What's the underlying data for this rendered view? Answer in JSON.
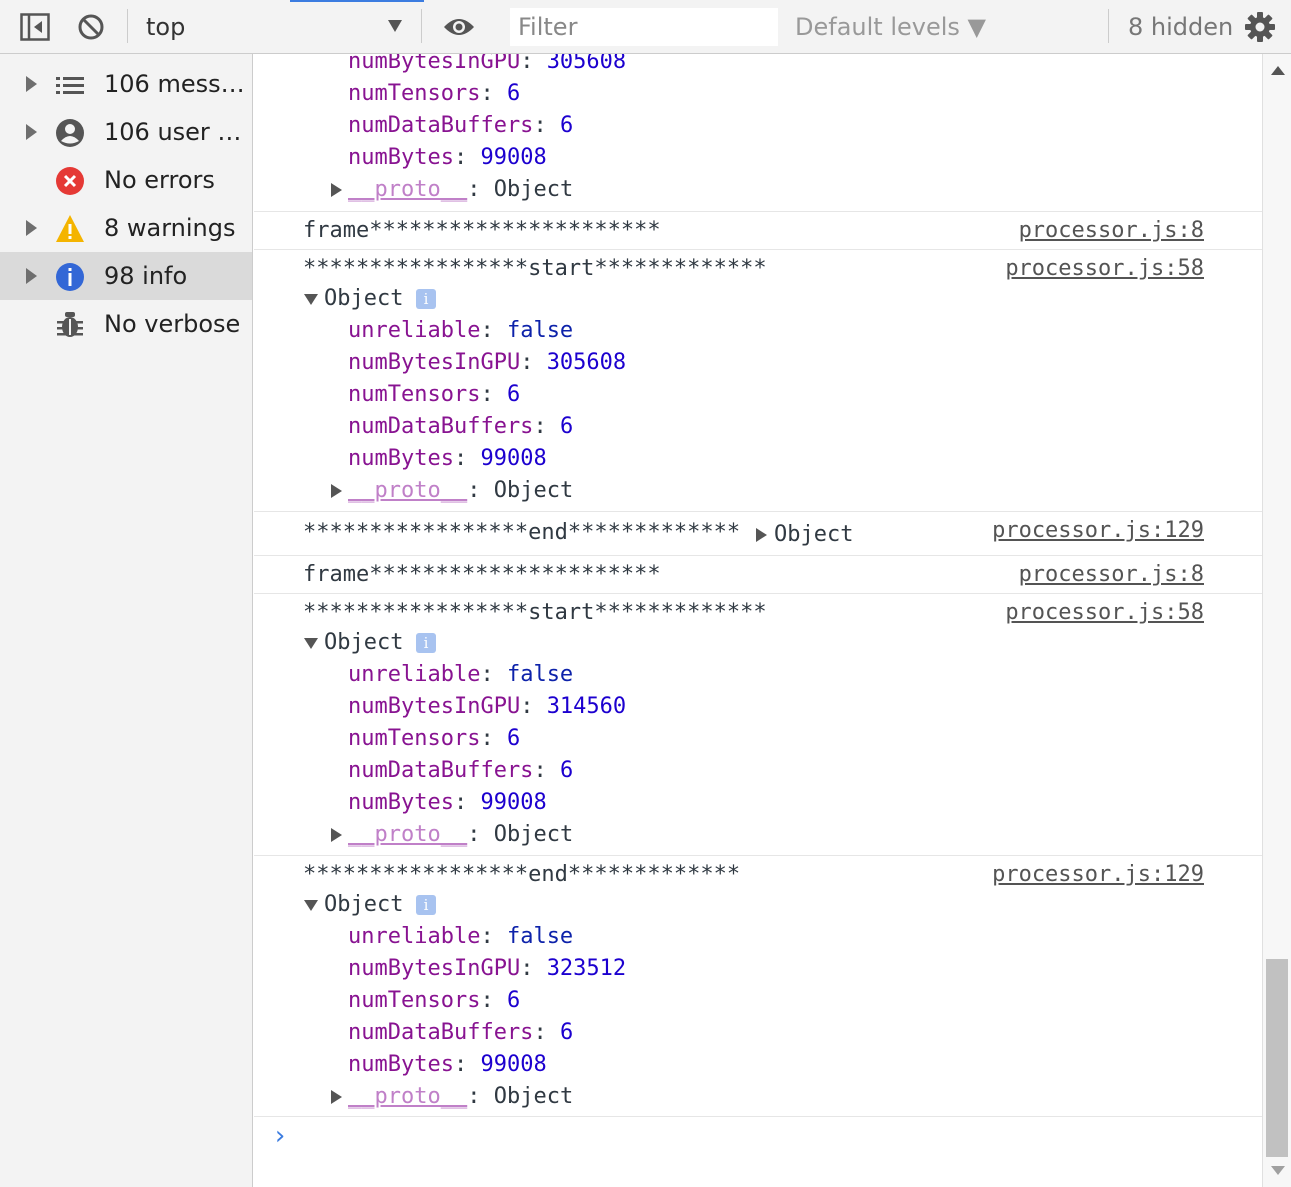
{
  "toolbar": {
    "context": "top",
    "filter_placeholder": "Filter",
    "levels_label": "Default levels ▼",
    "hidden_count": "8 hidden",
    "accent_color": "#3b7ce0"
  },
  "sidebar": {
    "items": [
      {
        "label": "106 messages",
        "icon": "list-icon"
      },
      {
        "label": "106 user messages",
        "icon": "user-icon"
      },
      {
        "label": "No errors",
        "icon": "error-icon"
      },
      {
        "label": "8 warnings",
        "icon": "warning-icon"
      },
      {
        "label": "98 info",
        "icon": "info-icon"
      },
      {
        "label": "No verbose",
        "icon": "bug-icon"
      }
    ]
  },
  "console": {
    "top_props": {
      "numBytesInGPU": "305608",
      "numTensors": "6",
      "numDataBuffers": "6",
      "numBytes": "99008",
      "proto": "__proto__",
      "proto_value": "Object"
    },
    "entries": [
      {
        "text": "frame**********************",
        "source": "processor.js:8"
      },
      {
        "text": "*****************start*************",
        "source": "processor.js:58",
        "object_label": "Object",
        "props": {
          "unreliable": "false",
          "numBytesInGPU": "305608",
          "numTensors": "6",
          "numDataBuffers": "6",
          "numBytes": "99008",
          "proto": "__proto__",
          "proto_value": "Object"
        }
      },
      {
        "text": "*****************end*************",
        "inline_object": "Object",
        "source": "processor.js:129"
      },
      {
        "text": "frame**********************",
        "source": "processor.js:8"
      },
      {
        "text": "*****************start*************",
        "source": "processor.js:58",
        "object_label": "Object",
        "props": {
          "unreliable": "false",
          "numBytesInGPU": "314560",
          "numTensors": "6",
          "numDataBuffers": "6",
          "numBytes": "99008",
          "proto": "__proto__",
          "proto_value": "Object"
        }
      },
      {
        "text": "*****************end*************",
        "source": "processor.js:129",
        "object_label": "Object",
        "props": {
          "unreliable": "false",
          "numBytesInGPU": "323512",
          "numTensors": "6",
          "numDataBuffers": "6",
          "numBytes": "99008",
          "proto": "__proto__",
          "proto_value": "Object"
        }
      }
    ],
    "keys": {
      "unreliable": "unreliable",
      "numBytesInGPU": "numBytesInGPU",
      "numTensors": "numTensors",
      "numDataBuffers": "numDataBuffers",
      "numBytes": "numBytes"
    },
    "info_badge": "i",
    "prompt": "›"
  }
}
